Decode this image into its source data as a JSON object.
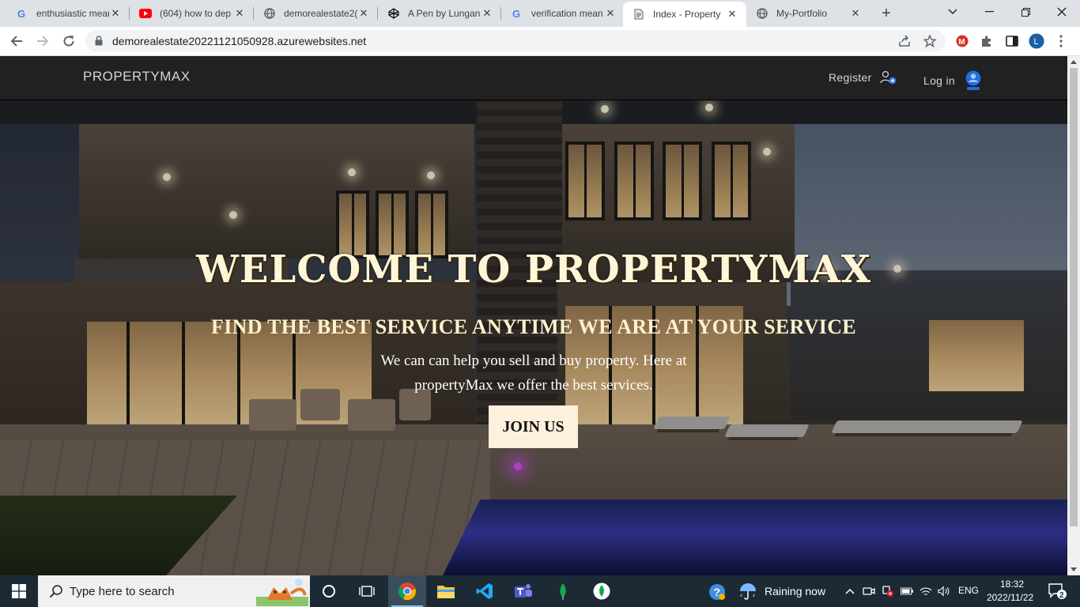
{
  "browser": {
    "tabs": [
      {
        "title": "enthusiastic mean",
        "favicon": "google-icon"
      },
      {
        "title": "(604) how to dep",
        "favicon": "youtube-icon"
      },
      {
        "title": "demorealestate2(",
        "favicon": "globe-icon"
      },
      {
        "title": "A Pen by Lungani",
        "favicon": "codepen-icon"
      },
      {
        "title": "verification mean",
        "favicon": "google-icon"
      },
      {
        "title": "Index - Property",
        "favicon": "page-icon",
        "active": true
      },
      {
        "title": "My-Portfolio",
        "favicon": "globe-icon"
      }
    ],
    "close_glyph": "✕",
    "new_tab_glyph": "+",
    "url": "demorealestate20221121050928.azurewebsites.net",
    "profile_initial": "L",
    "extension_badge": "M"
  },
  "site": {
    "brand": "PROPERTYMAX",
    "nav": {
      "register": "Register",
      "login": "Log in"
    },
    "hero": {
      "title": "WELCOME TO PROPERTYMAX",
      "subtitle": "FIND THE BEST SERVICE ANYTIME WE ARE AT YOUR SERVICE",
      "description": "We can can help you sell and buy property. Here at propertyMax we offer the best services.",
      "cta": "JOIN US"
    },
    "colors": {
      "navbar": "#212121",
      "cta_bg": "#fdf0dc",
      "title_text": "#fff6d8"
    }
  },
  "taskbar": {
    "search_placeholder": "Type here to search",
    "weather": "Raining now",
    "language": "ENG",
    "time": "18:32",
    "date": "2022/11/22",
    "notification_count": "2"
  }
}
